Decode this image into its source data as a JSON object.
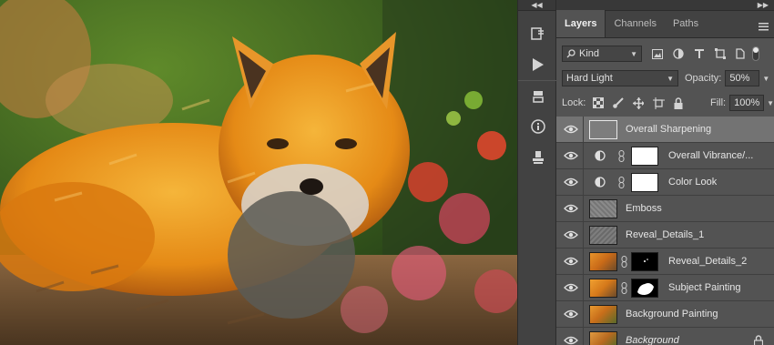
{
  "panel": {
    "tabs": [
      "Layers",
      "Channels",
      "Paths"
    ],
    "filter_kind": "Kind",
    "blend_mode": "Hard Light",
    "opacity_label": "Opacity:",
    "opacity_value": "50%",
    "lock_label": "Lock:",
    "fill_label": "Fill:",
    "fill_value": "100%"
  },
  "layers": [
    {
      "name": "Overall Sharpening",
      "selected": true
    },
    {
      "name": "Overall Vibrance/...",
      "type": "adjustment"
    },
    {
      "name": "Color Look",
      "type": "adjustment"
    },
    {
      "name": "Emboss"
    },
    {
      "name": "Reveal_Details_1"
    },
    {
      "name": "Reveal_Details_2",
      "mask": true
    },
    {
      "name": "Subject Painting",
      "mask": true
    },
    {
      "name": "Background Painting"
    },
    {
      "name": "Background",
      "locked": true
    }
  ],
  "icons": {
    "toolstrip": [
      "history-icon",
      "actions-play-icon",
      "3d-icon",
      "info-icon",
      "stamp-icon"
    ],
    "filters": [
      "image-filter-icon",
      "adjustment-filter-icon",
      "type-filter-icon",
      "shape-filter-icon",
      "smartobject-filter-icon",
      "filter-toggle-icon"
    ],
    "locks": [
      "lock-transparent-icon",
      "lock-pixels-icon",
      "lock-position-icon",
      "lock-artboard-icon",
      "lock-all-icon"
    ]
  },
  "colors": {
    "panel_bg": "#535353",
    "selected_layer": "#737373",
    "toolstrip_bg": "#424242"
  }
}
